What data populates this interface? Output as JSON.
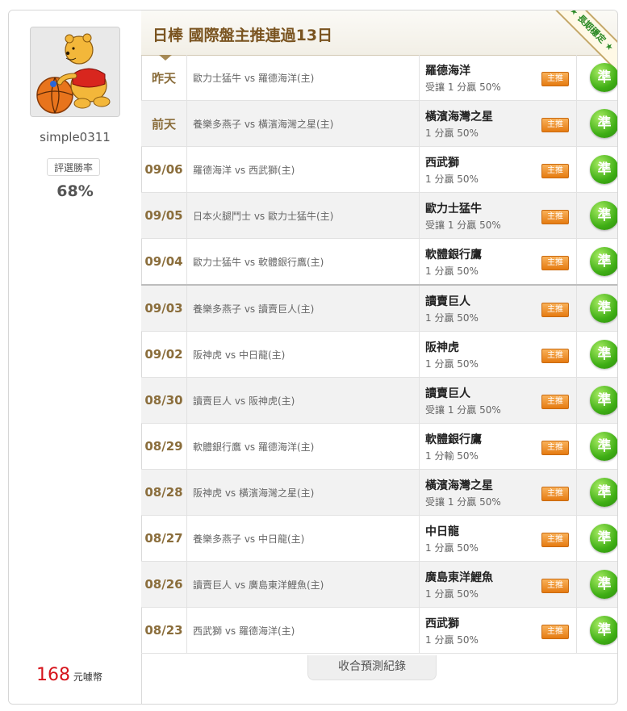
{
  "user": {
    "name": "simple0311",
    "rate_label": "評選勝率",
    "rate_value": "68%",
    "coins_value": "168",
    "coins_unit": "元噱幣"
  },
  "header": {
    "title": "日棒 國際盤主推連過13日",
    "ribbon": "長期穩定"
  },
  "rows": [
    {
      "date": "昨天",
      "match": "歐力士猛牛 vs 羅德海洋(主)",
      "team": "羅德海洋",
      "odds": "受讓 1 分贏 50%",
      "badge": "主推",
      "result": "準"
    },
    {
      "date": "前天",
      "match": "養樂多燕子 vs 橫濱海灣之星(主)",
      "team": "橫濱海灣之星",
      "odds": "1 分贏 50%",
      "badge": "主推",
      "result": "準"
    },
    {
      "date": "09/06",
      "match": "羅德海洋 vs 西武獅(主)",
      "team": "西武獅",
      "odds": "1 分贏 50%",
      "badge": "主推",
      "result": "準"
    },
    {
      "date": "09/05",
      "match": "日本火腿鬥士 vs 歐力士猛牛(主)",
      "team": "歐力士猛牛",
      "odds": "受讓 1 分贏 50%",
      "badge": "主推",
      "result": "準"
    },
    {
      "date": "09/04",
      "match": "歐力士猛牛 vs 軟體銀行鷹(主)",
      "team": "軟體銀行鷹",
      "odds": "1 分贏 50%",
      "badge": "主推",
      "result": "準"
    },
    {
      "date": "09/03",
      "match": "養樂多燕子 vs 讀賣巨人(主)",
      "team": "讀賣巨人",
      "odds": "1 分贏 50%",
      "badge": "主推",
      "result": "準"
    },
    {
      "date": "09/02",
      "match": "阪神虎 vs 中日龍(主)",
      "team": "阪神虎",
      "odds": "1 分贏 50%",
      "badge": "主推",
      "result": "準"
    },
    {
      "date": "08/30",
      "match": "讀賣巨人 vs 阪神虎(主)",
      "team": "讀賣巨人",
      "odds": "受讓 1 分贏 50%",
      "badge": "主推",
      "result": "準"
    },
    {
      "date": "08/29",
      "match": "軟體銀行鷹 vs 羅德海洋(主)",
      "team": "軟體銀行鷹",
      "odds": "1 分輸 50%",
      "badge": "主推",
      "result": "準"
    },
    {
      "date": "08/28",
      "match": "阪神虎 vs 橫濱海灣之星(主)",
      "team": "橫濱海灣之星",
      "odds": "受讓 1 分贏 50%",
      "badge": "主推",
      "result": "準"
    },
    {
      "date": "08/27",
      "match": "養樂多燕子 vs 中日龍(主)",
      "team": "中日龍",
      "odds": "1 分贏 50%",
      "badge": "主推",
      "result": "準"
    },
    {
      "date": "08/26",
      "match": "讀賣巨人 vs 廣島東洋鯉魚(主)",
      "team": "廣島東洋鯉魚",
      "odds": "1 分贏 50%",
      "badge": "主推",
      "result": "準"
    },
    {
      "date": "08/23",
      "match": "西武獅 vs 羅德海洋(主)",
      "team": "西武獅",
      "odds": "1 分贏 50%",
      "badge": "主推",
      "result": "準"
    }
  ],
  "footer": {
    "collapse_label": "收合預測紀錄"
  }
}
